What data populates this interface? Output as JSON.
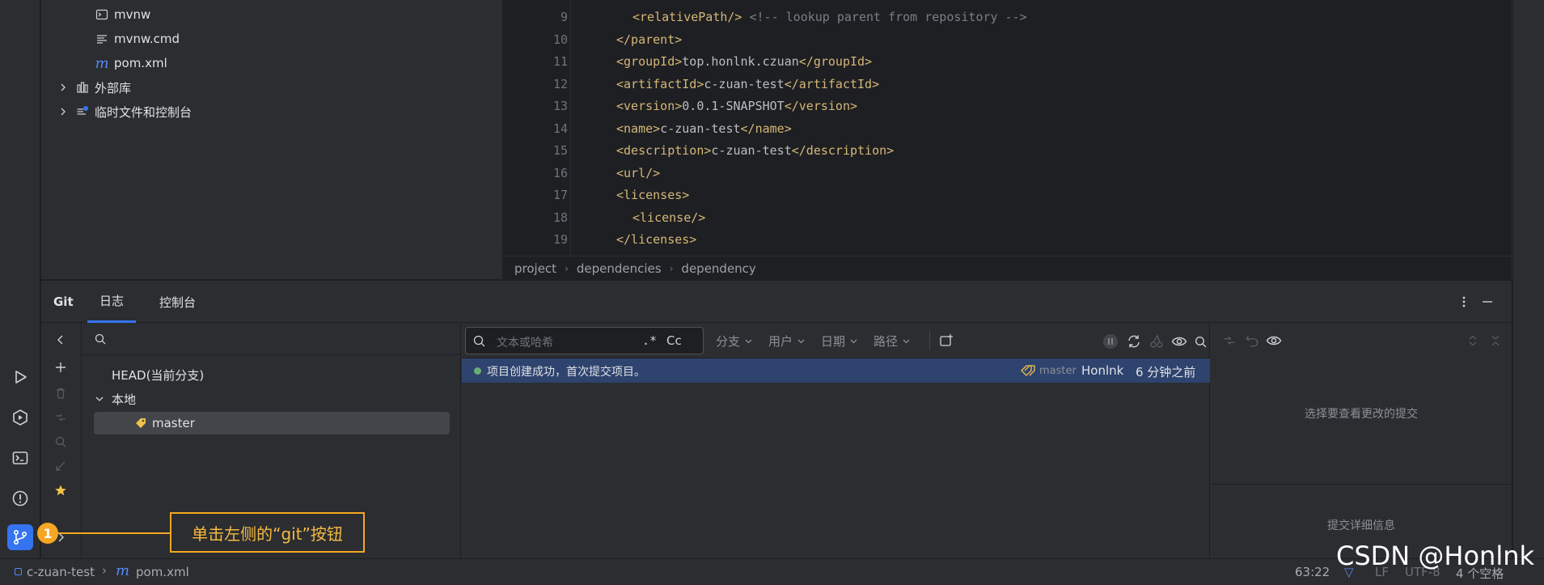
{
  "project_tree": {
    "items": [
      {
        "label": "mvnw",
        "icon": "terminal-file-icon"
      },
      {
        "label": "mvnw.cmd",
        "icon": "text-file-icon"
      },
      {
        "label": "pom.xml",
        "icon": "maven-icon"
      },
      {
        "label": "外部库",
        "icon": "library-icon"
      },
      {
        "label": "临时文件和控制台",
        "icon": "scratches-icon"
      }
    ]
  },
  "editor": {
    "lines": [
      {
        "num": "9",
        "tag_open": "<relativePath/>",
        "text": " ",
        "comment": "<!-- lookup parent from repository -->",
        "tag_close": ""
      },
      {
        "num": "10",
        "tag_open": "</parent>",
        "text": "",
        "comment": "",
        "tag_close": ""
      },
      {
        "num": "11",
        "tag_open": "<groupId>",
        "text": "top.honlnk.czuan",
        "comment": "",
        "tag_close": "</groupId>"
      },
      {
        "num": "12",
        "tag_open": "<artifactId>",
        "text": "c-zuan-test",
        "comment": "",
        "tag_close": "</artifactId>"
      },
      {
        "num": "13",
        "tag_open": "<version>",
        "text": "0.0.1-SNAPSHOT",
        "comment": "",
        "tag_close": "</version>"
      },
      {
        "num": "14",
        "tag_open": "<name>",
        "text": "c-zuan-test",
        "comment": "",
        "tag_close": "</name>"
      },
      {
        "num": "15",
        "tag_open": "<description>",
        "text": "c-zuan-test",
        "comment": "",
        "tag_close": "</description>"
      },
      {
        "num": "16",
        "tag_open": "<url/>",
        "text": "",
        "comment": "",
        "tag_close": ""
      },
      {
        "num": "17",
        "tag_open": "<licenses>",
        "text": "",
        "comment": "",
        "tag_close": ""
      },
      {
        "num": "18",
        "tag_open": "<license/>",
        "text": "",
        "comment": "",
        "tag_close": ""
      },
      {
        "num": "19",
        "tag_open": "</licenses>",
        "text": "",
        "comment": "",
        "tag_close": ""
      }
    ],
    "breadcrumb": [
      "project",
      "dependencies",
      "dependency"
    ]
  },
  "git": {
    "title": "Git",
    "tabs": [
      "日志",
      "控制台"
    ],
    "branches": {
      "head": "HEAD(当前分支)",
      "local": "本地",
      "master": "master"
    },
    "log": {
      "search_placeholder": "文本或哈希",
      "regex": ".*",
      "case": "Cc",
      "filters": [
        "分支",
        "用户",
        "日期",
        "路径"
      ],
      "commits": [
        {
          "message": "项目创建成功，首次提交项目。",
          "branch": "master",
          "author": "Honlnk",
          "time": "6 分钟之前"
        }
      ]
    },
    "details": {
      "select_hint": "选择要查看更改的提交",
      "commit_details": "提交详细信息"
    }
  },
  "annotation": {
    "number": "1",
    "text": "单击左侧的“git”按钮"
  },
  "status_bar": {
    "project": "c-zuan-test",
    "file": "pom.xml",
    "position": "63:22",
    "line_sep": "LF",
    "encoding": "UTF-8",
    "indent": "4 个空格"
  },
  "watermark": "CSDN @Honlnk",
  "colors": {
    "accent": "#3574f0",
    "tag": "#d5b778",
    "annotation": "#f5a623",
    "commit_dot": "#6aab73"
  }
}
